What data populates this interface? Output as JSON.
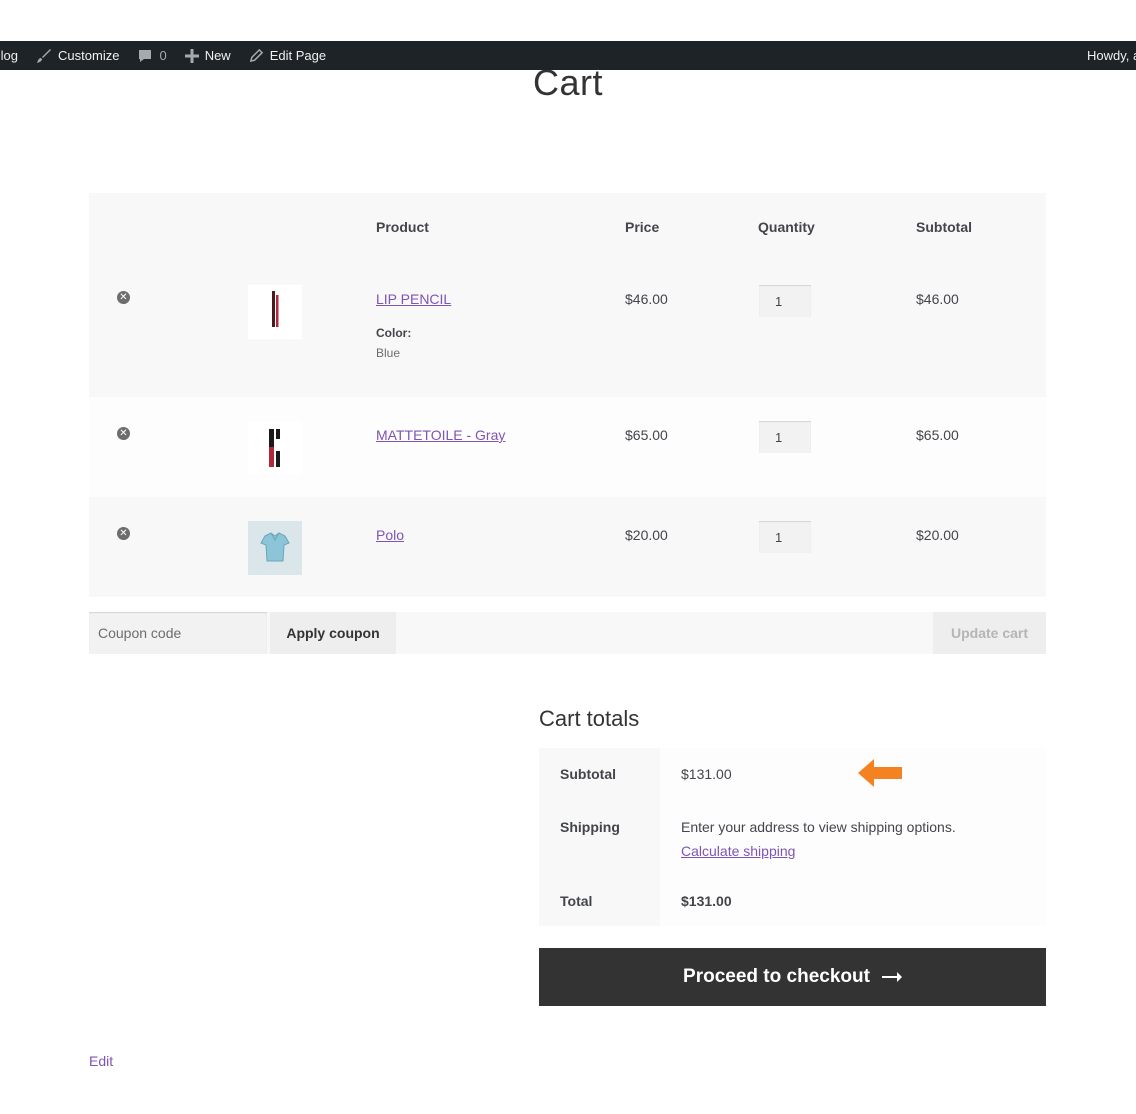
{
  "admin_bar": {
    "site_label": "Blog",
    "customize_label": "Customize",
    "comments_count": "0",
    "new_label": "New",
    "edit_page_label": "Edit Page",
    "howdy_label": "Howdy, ad"
  },
  "page": {
    "title": "Cart"
  },
  "cart_table": {
    "headers": {
      "product": "Product",
      "price": "Price",
      "quantity": "Quantity",
      "subtotal": "Subtotal"
    },
    "items": [
      {
        "name": "LIP PENCIL",
        "variation_key": "Color:",
        "variation_value": "Blue",
        "price": "$46.00",
        "quantity": "1",
        "subtotal": "$46.00",
        "thumbnail": "lip-pencil-image"
      },
      {
        "name": "MATTETOILE - Gray",
        "price": "$65.00",
        "quantity": "1",
        "subtotal": "$65.00",
        "thumbnail": "mattetoile-image"
      },
      {
        "name": "Polo",
        "price": "$20.00",
        "quantity": "1",
        "subtotal": "$20.00",
        "thumbnail": "polo-shirt-image"
      }
    ]
  },
  "actions": {
    "coupon_placeholder": "Coupon code",
    "apply_coupon_label": "Apply coupon",
    "update_cart_label": "Update cart"
  },
  "cart_totals": {
    "title": "Cart totals",
    "subtotal_label": "Subtotal",
    "subtotal_value": "$131.00",
    "shipping_label": "Shipping",
    "shipping_note": "Enter your address to view shipping options.",
    "calculate_shipping_label": "Calculate shipping",
    "total_label": "Total",
    "total_value": "$131.00"
  },
  "checkout": {
    "label": "Proceed to checkout"
  },
  "footer": {
    "edit_label": "Edit"
  },
  "colors": {
    "accent": "#7f54b3",
    "admin_bar": "#1d2327",
    "checkout_bg": "#333333",
    "annotation_arrow": "#f58220"
  }
}
